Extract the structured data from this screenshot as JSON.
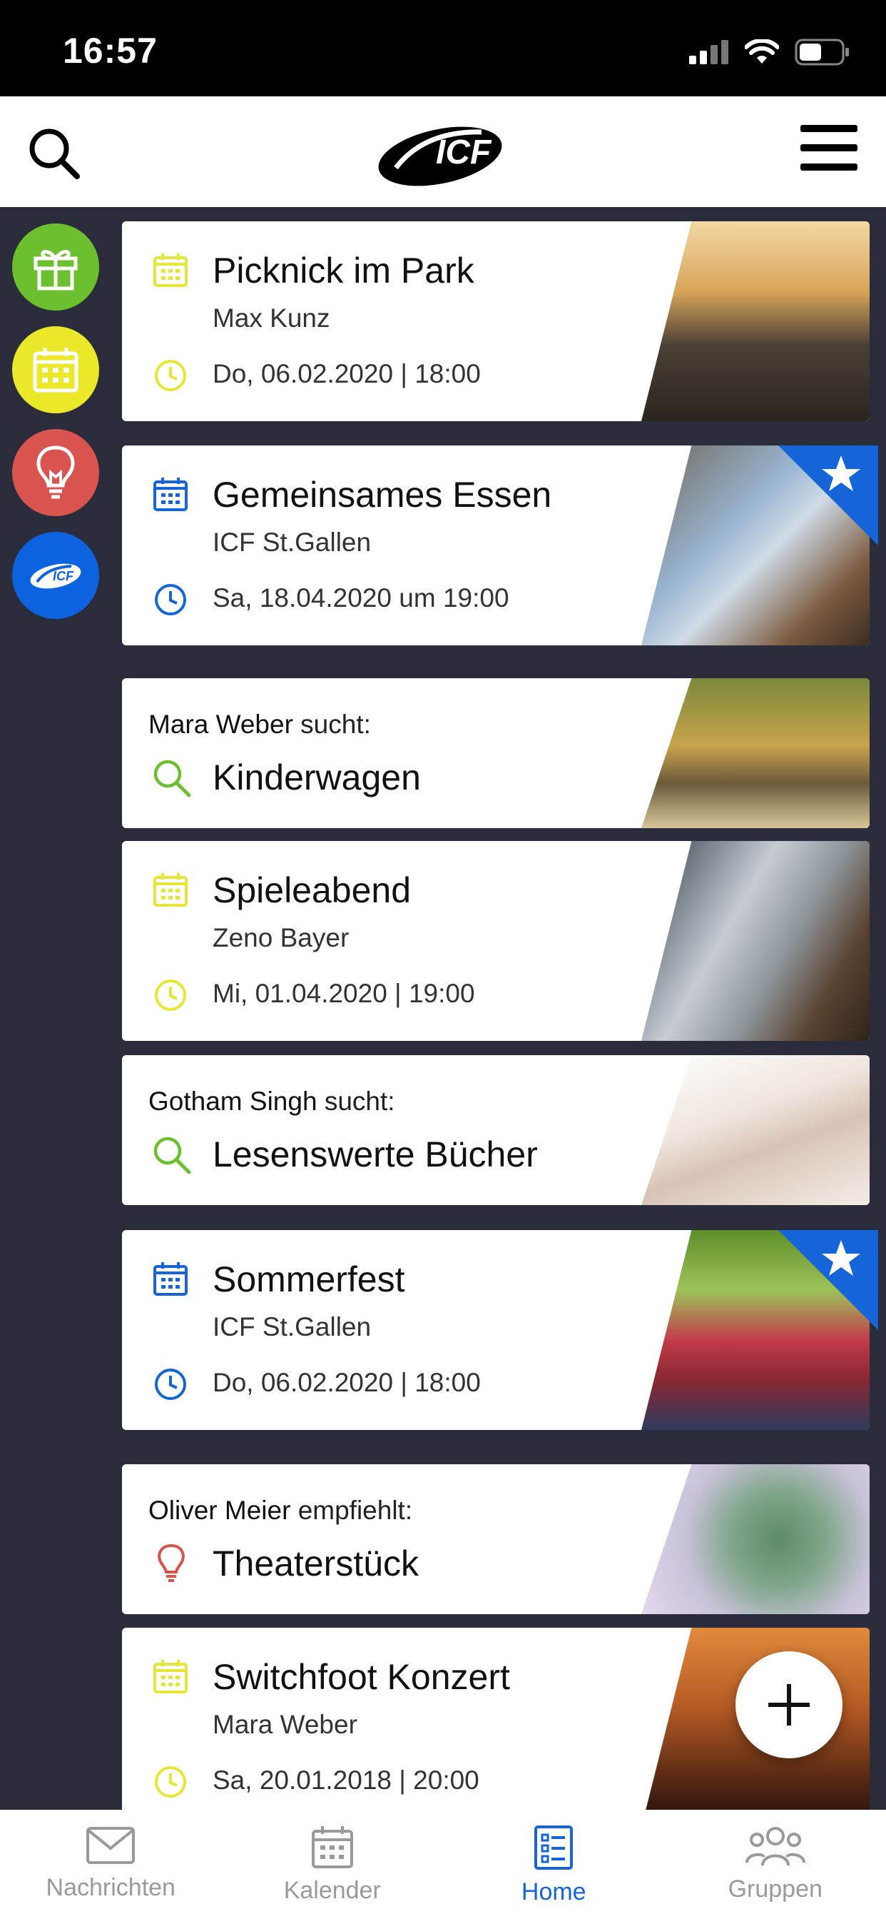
{
  "status": {
    "time": "16:57"
  },
  "header": {
    "logo_text": "ICF"
  },
  "cards": [
    {
      "type": "event",
      "title": "Picknick im Park",
      "subtitle": "Max Kunz",
      "date": "Do, 06.02.2020 | 18:00",
      "accent": "#e8e635",
      "starred": false
    },
    {
      "type": "event",
      "title": "Gemeinsames Essen",
      "subtitle": "ICF St.Gallen",
      "date": "Sa, 18.04.2020 um 19:00",
      "accent": "#1565d8",
      "starred": true
    },
    {
      "type": "request",
      "who": "Mara Weber",
      "verb": "sucht:",
      "title": "Kinderwagen",
      "accent": "#6cc030"
    },
    {
      "type": "event",
      "title": "Spieleabend",
      "subtitle": "Zeno Bayer",
      "date": "Mi, 01.04.2020 | 19:00",
      "accent": "#e8e635",
      "starred": false
    },
    {
      "type": "request",
      "who": "Gotham Singh",
      "verb": "sucht:",
      "title": "Lesenswerte Bücher",
      "accent": "#6cc030"
    },
    {
      "type": "event",
      "title": "Sommerfest",
      "subtitle": "ICF St.Gallen",
      "date": "Do, 06.02.2020 | 18:00",
      "accent": "#1565d8",
      "starred": true
    },
    {
      "type": "recommend",
      "who": "Oliver Meier",
      "verb": "empfiehlt:",
      "title": "Theaterstück",
      "accent": "#d9534f"
    },
    {
      "type": "event",
      "title": "Switchfoot Konzert",
      "subtitle": "Mara Weber",
      "date": "Sa, 20.01.2018 | 20:00",
      "accent": "#e8e635",
      "starred": false
    }
  ],
  "tabs": [
    {
      "label": "Nachrichten",
      "icon": "mail-icon",
      "active": false
    },
    {
      "label": "Kalender",
      "icon": "calendar-icon",
      "active": false
    },
    {
      "label": "Home",
      "icon": "list-icon",
      "active": true
    },
    {
      "label": "Gruppen",
      "icon": "group-icon",
      "active": false
    }
  ],
  "colors": {
    "active": "#1565d8",
    "inactive": "#9a9a9a",
    "background": "#2b2c3b"
  }
}
